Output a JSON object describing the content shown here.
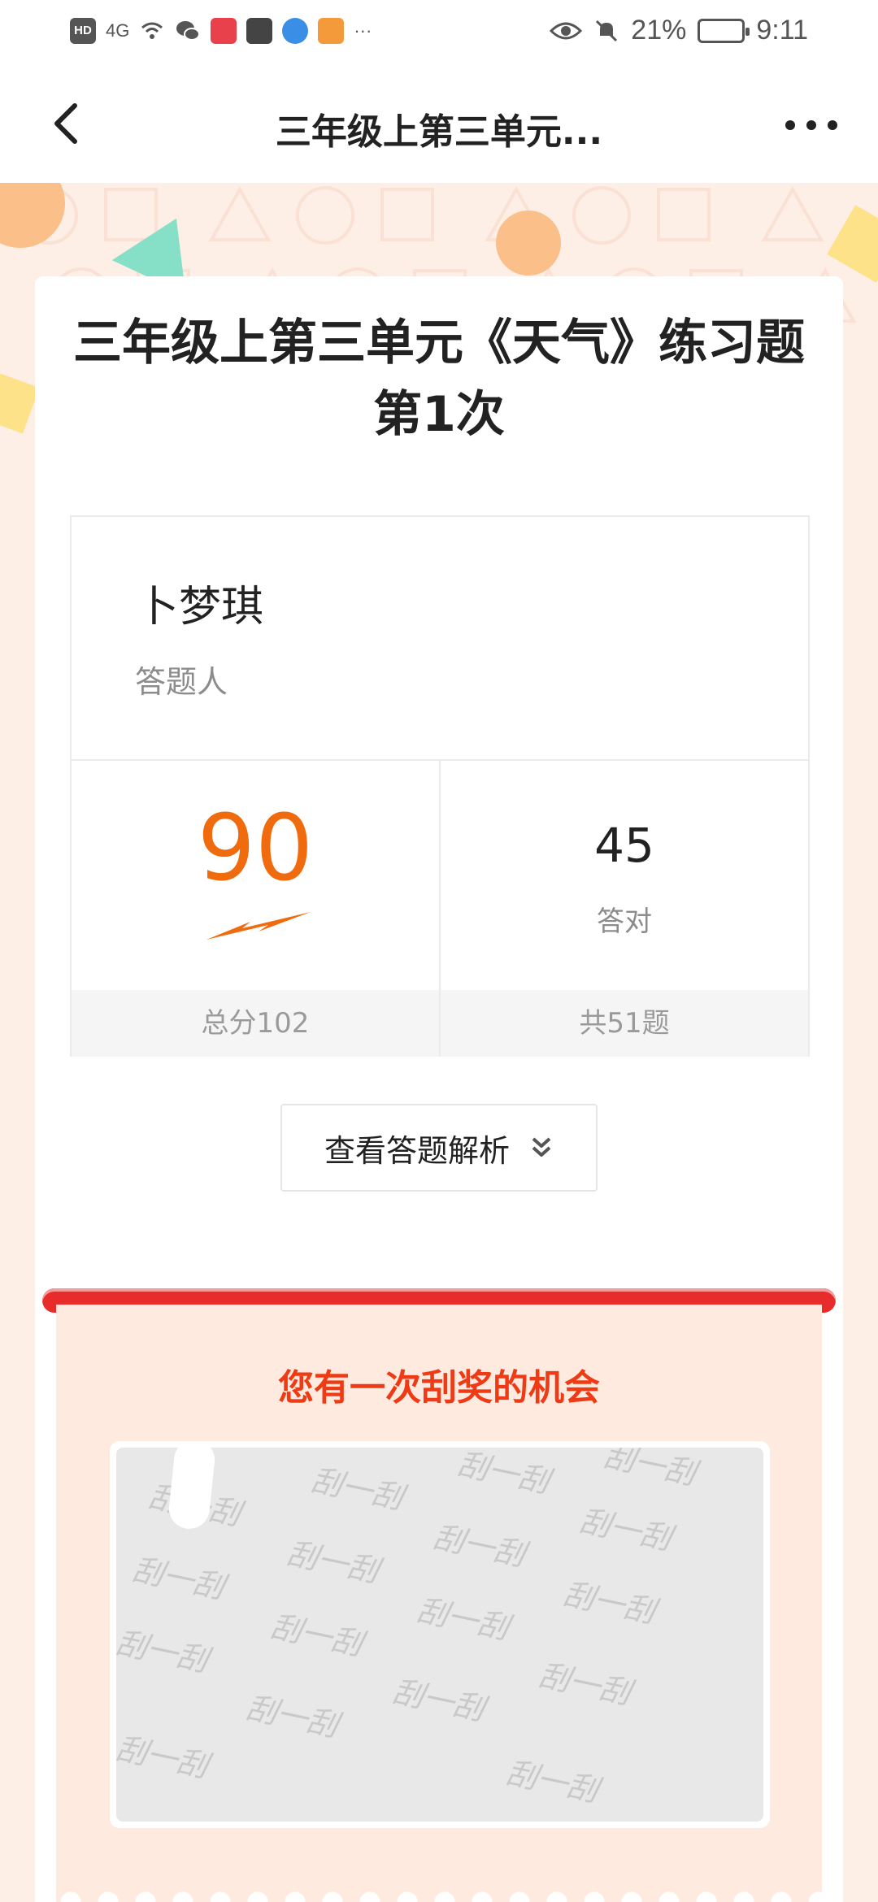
{
  "status_bar": {
    "signal_label": "4G",
    "hd_label": "HD",
    "more_apps": "···",
    "battery": "21%",
    "time": "9:11"
  },
  "nav": {
    "title": "三年级上第三单元..."
  },
  "quiz": {
    "title_line1": "三年级上第三单元《天气》练习题",
    "title_line2": "第1次"
  },
  "respondent": {
    "name": "卜梦琪",
    "label": "答题人"
  },
  "stats": {
    "score": "90",
    "total_score": "总分102",
    "correct_count": "45",
    "correct_label": "答对",
    "question_total": "共51题"
  },
  "analysis_button": {
    "label": "查看答题解析"
  },
  "lottery": {
    "title": "您有一次刮奖的机会",
    "scratch_text": "刮一刮"
  },
  "colors": {
    "accent_orange": "#f06a0e",
    "lottery_red": "#ee3b16",
    "page_background": "#fdeee6"
  }
}
